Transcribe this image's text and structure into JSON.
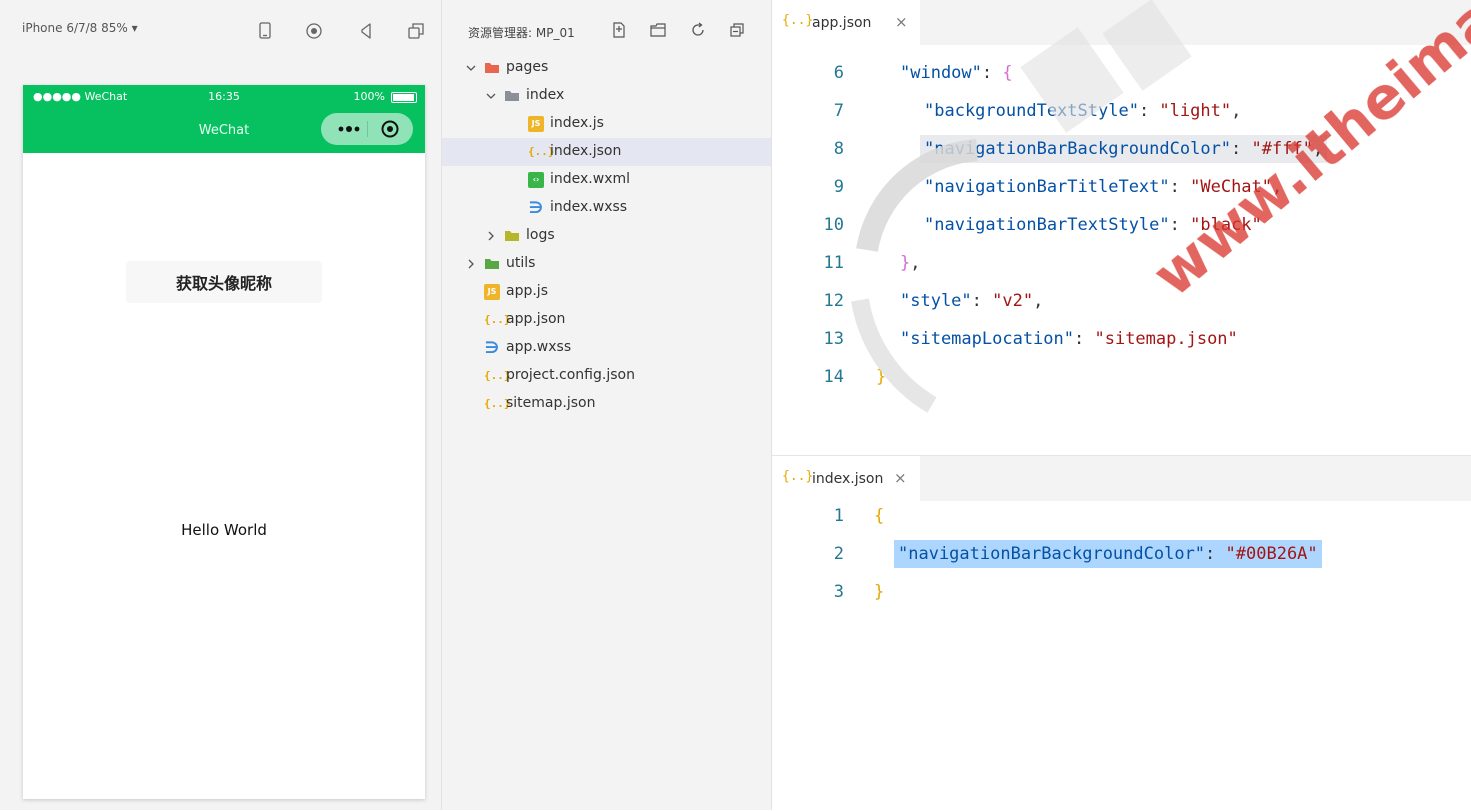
{
  "simulator": {
    "device": "iPhone 6/7/8 85% ▾",
    "status": {
      "carrier": "●●●●● WeChat",
      "time": "16:35",
      "battery": "100%"
    },
    "nav_title": "WeChat",
    "avatar_button": "获取头像昵称",
    "hello_text": "Hello World",
    "colors": {
      "navbar": "#07c160"
    }
  },
  "explorer": {
    "title": "资源管理器: MP_01",
    "tree": [
      {
        "label": "pages",
        "type": "folder",
        "expanded": true,
        "level": 0,
        "icon": "folder-pages-icon"
      },
      {
        "label": "index",
        "type": "folder",
        "expanded": true,
        "level": 1,
        "icon": "folder-icon"
      },
      {
        "label": "index.js",
        "type": "js",
        "level": 2,
        "icon": "js-file-icon"
      },
      {
        "label": "index.json",
        "type": "json",
        "level": 2,
        "selected": true,
        "icon": "json-file-icon"
      },
      {
        "label": "index.wxml",
        "type": "wxml",
        "level": 2,
        "icon": "wxml-file-icon"
      },
      {
        "label": "index.wxss",
        "type": "wxss",
        "level": 2,
        "icon": "wxss-file-icon"
      },
      {
        "label": "logs",
        "type": "folder",
        "expanded": false,
        "level": 1,
        "icon": "folder-logs-icon"
      },
      {
        "label": "utils",
        "type": "folder",
        "expanded": false,
        "level": 0,
        "icon": "folder-utils-icon"
      },
      {
        "label": "app.js",
        "type": "js",
        "level": 0,
        "icon": "js-file-icon"
      },
      {
        "label": "app.json",
        "type": "json",
        "level": 0,
        "icon": "json-file-icon"
      },
      {
        "label": "app.wxss",
        "type": "wxss",
        "level": 0,
        "icon": "wxss-file-icon"
      },
      {
        "label": "project.config.json",
        "type": "json",
        "level": 0,
        "icon": "json-file-icon"
      },
      {
        "label": "sitemap.json",
        "type": "json",
        "level": 0,
        "icon": "json-file-icon"
      }
    ]
  },
  "editor_top": {
    "tab": {
      "label": "app.json",
      "close": "×",
      "icon_glyph": "{..}"
    },
    "lines": [
      {
        "n": "6",
        "indent": 1,
        "tokens": [
          [
            "k",
            "\"window\""
          ],
          [
            "p",
            ": "
          ],
          [
            "brace2",
            "{"
          ]
        ]
      },
      {
        "n": "7",
        "indent": 2,
        "tokens": [
          [
            "k",
            "\"backgroundTextStyle\""
          ],
          [
            "p",
            ": "
          ],
          [
            "s",
            "\"light\""
          ],
          [
            "p",
            ","
          ]
        ]
      },
      {
        "n": "8",
        "indent": 2,
        "highlight": true,
        "tokens": [
          [
            "k",
            "\"navigationBarBackgroundColor\""
          ],
          [
            "p",
            ": "
          ],
          [
            "s",
            "\"#fff\""
          ],
          [
            "p",
            ","
          ]
        ]
      },
      {
        "n": "9",
        "indent": 2,
        "tokens": [
          [
            "k",
            "\"navigationBarTitleText\""
          ],
          [
            "p",
            ": "
          ],
          [
            "s",
            "\"WeChat\""
          ],
          [
            "p",
            ","
          ]
        ]
      },
      {
        "n": "10",
        "indent": 2,
        "tokens": [
          [
            "k",
            "\"navigationBarTextStyle\""
          ],
          [
            "p",
            ": "
          ],
          [
            "s",
            "\"black\""
          ]
        ]
      },
      {
        "n": "11",
        "indent": 1,
        "tokens": [
          [
            "brace2",
            "}"
          ],
          [
            "p",
            ","
          ]
        ]
      },
      {
        "n": "12",
        "indent": 1,
        "tokens": [
          [
            "k",
            "\"style\""
          ],
          [
            "p",
            ": "
          ],
          [
            "s",
            "\"v2\""
          ],
          [
            "p",
            ","
          ]
        ]
      },
      {
        "n": "13",
        "indent": 1,
        "tokens": [
          [
            "k",
            "\"sitemapLocation\""
          ],
          [
            "p",
            ": "
          ],
          [
            "s",
            "\"sitemap.json\""
          ]
        ]
      },
      {
        "n": "14",
        "indent": 0,
        "tokens": [
          [
            "brace1",
            "}"
          ]
        ]
      }
    ]
  },
  "editor_bottom": {
    "tab": {
      "label": "index.json",
      "close": "×",
      "icon_glyph": "{..}"
    },
    "lines": [
      {
        "n": "1",
        "indent": 0,
        "tokens": [
          [
            "brace1",
            "{"
          ]
        ]
      },
      {
        "n": "2",
        "indent": 1,
        "selected": true,
        "tokens": [
          [
            "k",
            "\"navigationBarBackgroundColor\""
          ],
          [
            "p",
            ": "
          ],
          [
            "s",
            "\"#00B26A\""
          ]
        ]
      },
      {
        "n": "3",
        "indent": 0,
        "tokens": [
          [
            "brace1",
            "}"
          ]
        ]
      }
    ]
  },
  "watermark": "www.itheima.com"
}
